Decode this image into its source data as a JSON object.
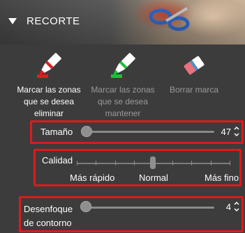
{
  "section": {
    "title": "RECORTE"
  },
  "tools": [
    {
      "label": "Marcar las zonas que se desea eliminar",
      "icon": "red-marker-icon",
      "enabled": true
    },
    {
      "label": "Marcar las zonas que se desea mantener",
      "icon": "green-marker-icon",
      "enabled": false
    },
    {
      "label": "Borrar marca",
      "icon": "eraser-icon",
      "enabled": false
    }
  ],
  "size": {
    "label": "Tamaño",
    "value": "47"
  },
  "quality": {
    "label": "Calidad",
    "left_label": "Más rápido",
    "center_label": "Normal",
    "right_label": "Más fino"
  },
  "blur": {
    "label": "Desenfoque de contorno",
    "value": "4"
  },
  "colors": {
    "highlight": "#e11919",
    "panel_bg": "#3c3c3c",
    "red_marker": "#e31b1b",
    "green_marker": "#1fbf3a",
    "eraser": "#e9717c"
  }
}
